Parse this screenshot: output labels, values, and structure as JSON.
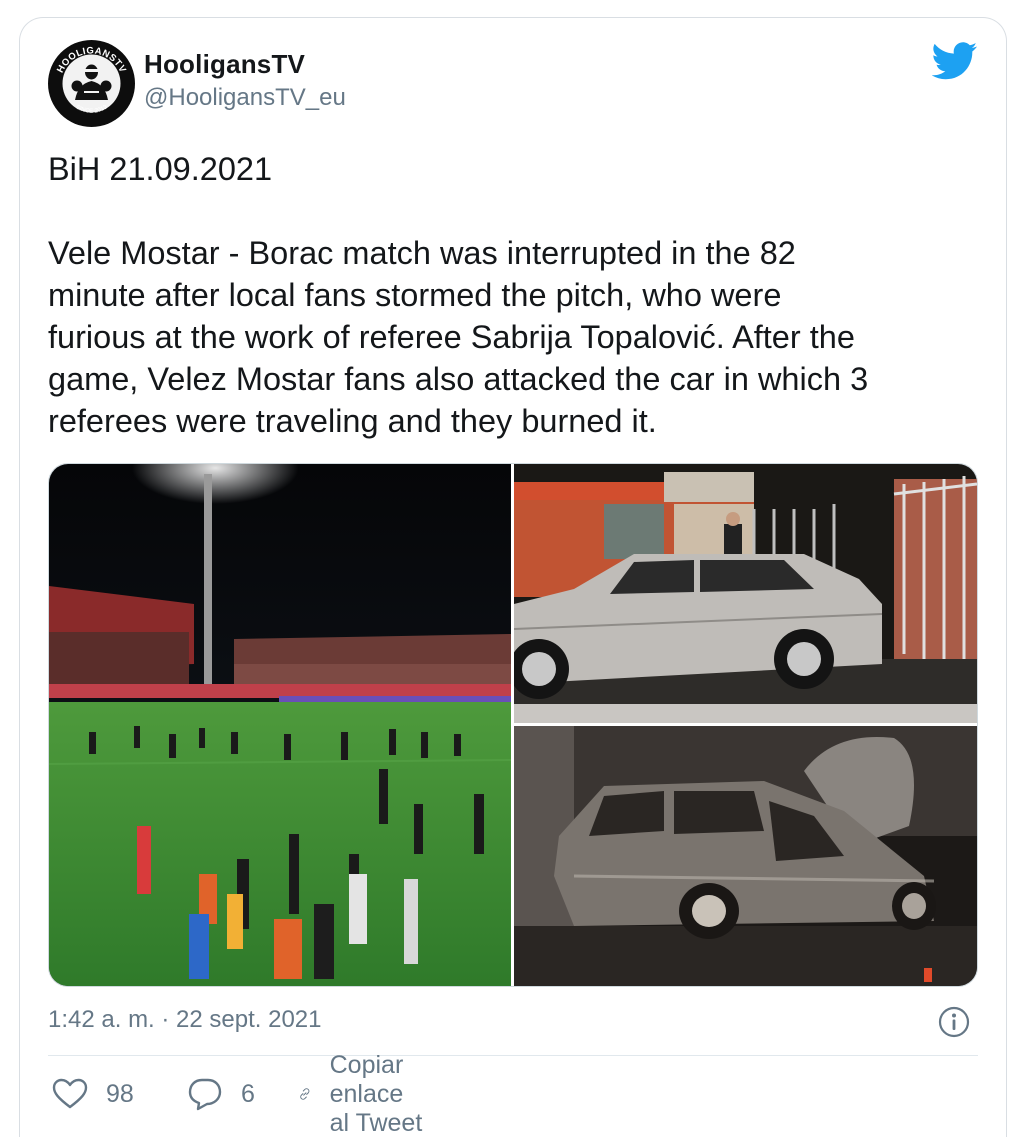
{
  "tweet": {
    "display_name": "HooligansTV",
    "handle": "@HooligansTV_eu",
    "avatar": {
      "logo_text_top": "HOOLIGANSTV",
      "logo_text_bottom": "SINCE 2013",
      "icon": "hooligan-fighter-logo"
    },
    "text_lines_1": [
      "BiH 21.09.2021"
    ],
    "text_lines_2": [
      "Vele Mostar - Borac match was interrupted in the 82",
      "minute after local fans stormed the pitch, who were",
      "furious at the work of referee Sabrija Topalović. After the",
      "game, Velez Mostar fans also attacked the car in which 3",
      "referees were traveling and they burned it."
    ],
    "timestamp": "1:42 a. m. · 22 sept. 2021",
    "likes": "98",
    "replies": "6",
    "copy_link_label": "Copiar enlace al Tweet"
  },
  "icons": {
    "brand": "twitter-bird-icon",
    "info": "info-icon",
    "like": "heart-icon",
    "reply": "speech-bubble-icon",
    "copy": "link-icon"
  },
  "colors": {
    "twitter_blue": "#1da1f2",
    "secondary_text": "#657786",
    "primary_text": "#14171a",
    "border": "#d9dee3"
  }
}
